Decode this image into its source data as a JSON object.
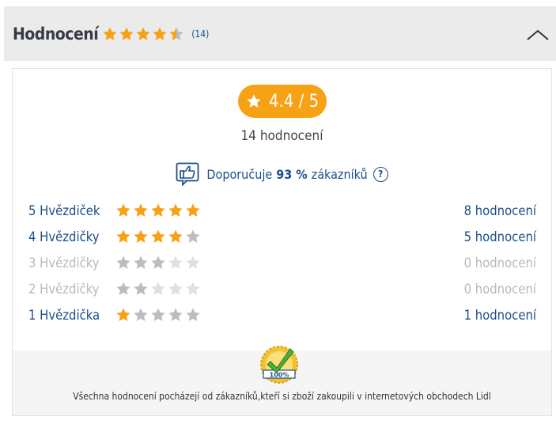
{
  "header": {
    "title": "Hodnocení",
    "count": "(14)",
    "stars_value": 4.5
  },
  "summary": {
    "star_icon": "star-icon",
    "rating": "4.4 / 5",
    "total": "14 hodnocení",
    "recommend_prefix": "Doporučuje",
    "recommend_percent": "93 %",
    "recommend_suffix": "zákazníků",
    "help_label": "?"
  },
  "breakdown": [
    {
      "label": "5 Hvězdiček",
      "stars": 5,
      "count": "8 hodnocení",
      "muted": false
    },
    {
      "label": "4 Hvězdičky",
      "stars": 4,
      "count": "5 hodnocení",
      "muted": false
    },
    {
      "label": "3 Hvězdičky",
      "stars": 3,
      "count": "0 hodnocení",
      "muted": true
    },
    {
      "label": "2 Hvězdičky",
      "stars": 2,
      "count": "0 hodnocení",
      "muted": true
    },
    {
      "label": "1 Hvězdička",
      "stars": 1,
      "count": "1 hodnocení",
      "muted": false
    }
  ],
  "footer": {
    "badge_text": "100%",
    "text": "Všechna hodnocení pocházejí od zákazníků,kteří si zboží zakoupili v internetových obchodech Lidl"
  },
  "colors": {
    "accent": "#f6a214",
    "link": "#1b4f8a",
    "star_empty_active": "#bdbdbd",
    "star_empty_muted": "#e0e0e0",
    "star_filled_muted": "#bdbdbd"
  }
}
